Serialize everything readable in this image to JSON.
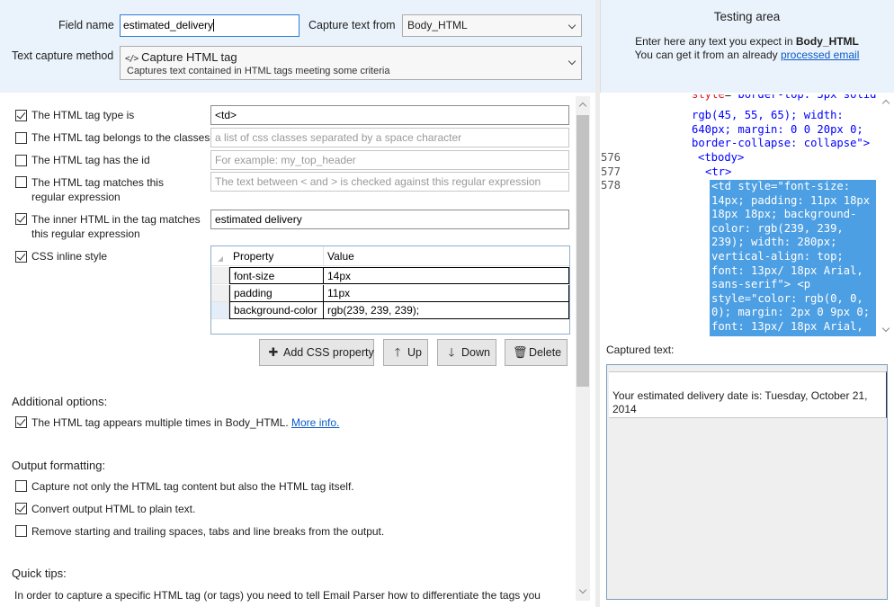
{
  "form": {
    "field_name_label": "Field name",
    "field_name_value": "estimated_delivery",
    "capture_from_label": "Capture text from",
    "capture_from_value": "Body_HTML",
    "method_label": "Text capture method",
    "method_title": "Capture HTML tag",
    "method_subtitle": "Captures text contained in HTML tags meeting some criteria",
    "method_icon": "code-tag-icon"
  },
  "criteria": [
    {
      "label": "The HTML tag type is",
      "checked": true,
      "value": "<td>",
      "placeholder": ""
    },
    {
      "label": "The HTML tag belongs to the classes",
      "checked": false,
      "value": "",
      "placeholder": "a list of css classes separated by a space character"
    },
    {
      "label": "The HTML tag has the id",
      "checked": false,
      "value": "",
      "placeholder": "For example: my_top_header"
    },
    {
      "label_line1": "The HTML tag matches this",
      "label_line2": "regular expression",
      "checked": false,
      "value": "",
      "placeholder": "The text between < and > is checked against this regular expression"
    },
    {
      "label_line1": "The inner HTML in the tag matches",
      "label_line2": "this regular expression",
      "checked": true,
      "value": "estimated delivery",
      "placeholder": ""
    },
    {
      "label": "CSS inline style",
      "checked": true
    }
  ],
  "css_grid": {
    "headers": [
      "Property",
      "Value"
    ],
    "rows": [
      {
        "property": "font-size",
        "value": "14px"
      },
      {
        "property": "padding",
        "value": "11px"
      },
      {
        "property": "background-color",
        "value": "rgb(239, 239, 239);"
      }
    ]
  },
  "buttons": {
    "add_css": "Add CSS property",
    "up": "Up",
    "down": "Down",
    "delete": "Delete"
  },
  "additional": {
    "title": "Additional options:",
    "multiple_text": "The HTML tag appears multiple times in Body_HTML.",
    "multiple_checked": true,
    "more_info": "More info."
  },
  "output": {
    "title": "Output formatting:",
    "options": [
      {
        "label": "Capture not only the HTML tag content but also the HTML tag itself.",
        "checked": false
      },
      {
        "label": "Convert output HTML to plain text.",
        "checked": true
      },
      {
        "label": "Remove starting and trailing spaces, tabs and line breaks from the output.",
        "checked": false
      }
    ]
  },
  "tips": {
    "title": "Quick tips:",
    "text": "In order to capture a specific HTML tag (or tags) you need to tell Email Parser how to differentiate the tags you"
  },
  "testing": {
    "title": "Testing area",
    "line1_prefix": "Enter here any text you expect in",
    "line1_bold": "Body_HTML",
    "line2_prefix": "You can get it from an already",
    "line2_link": "processed email",
    "captured_label": "Captured text:",
    "captured_text": "Your estimated delivery date is: Tuesday, October 21, 2014"
  },
  "editor": {
    "line_numbers": [
      "576",
      "577",
      "578"
    ],
    "partial_top": "style=\"border-top: 3px solid",
    "partial_top_attr": "style",
    "partial_top_val": "\"border-top: 3px solid",
    "cont_lines": [
      "rgb(45, 55, 65); width:",
      "640px; margin: 0 0 20px 0;",
      "border-collapse: collapse\">"
    ],
    "tbody": "<tbody>",
    "tr": "<tr>",
    "selected_lines": [
      "<td style=\"font-size:",
      "14px; padding: 11px 18px",
      "18px 18px; background-",
      "color: rgb(239, 239,",
      "239); width: 280px;",
      "vertical-align: top;",
      "font: 13px/ 18px Arial,",
      "sans-serif\"> <p",
      "style=\"color: rgb(0, 0,",
      "0); margin: 2px 0 9px 0;",
      "font: 13px/ 18px Arial,"
    ]
  },
  "colors": {
    "band_bg": "#eaf3fb",
    "selection": "#4d9fe3",
    "link": "#0b59c8",
    "attr": "#e0121f",
    "string": "#0000ff"
  }
}
